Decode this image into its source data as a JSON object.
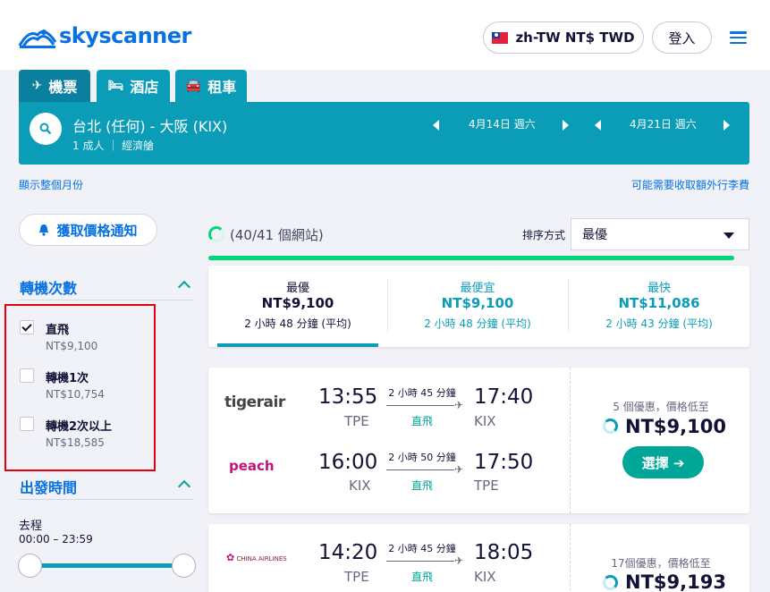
{
  "header": {
    "brand": "skyscanner",
    "locale": "zh-TW NT$ TWD",
    "login": "登入"
  },
  "tabs": [
    {
      "label": "機票",
      "icon": "plane-icon"
    },
    {
      "label": "酒店",
      "icon": "bed-icon"
    },
    {
      "label": "租車",
      "icon": "car-icon"
    }
  ],
  "search": {
    "route": "台北 (任何) - 大阪 (KIX)",
    "pax": "1 成人 ｜ 經濟艙",
    "depart_date": "4月14日 週六",
    "return_date": "4月21日 週六"
  },
  "links": {
    "month_view": "顯示整個月份",
    "baggage_note": "可能需要收取額外行李費"
  },
  "sidebar": {
    "alert_label": "獲取價格通知",
    "stops_title": "轉機次數",
    "stops": [
      {
        "label": "直飛",
        "price": "NT$9,100",
        "checked": true
      },
      {
        "label": "轉機1次",
        "price": "NT$10,754",
        "checked": false
      },
      {
        "label": "轉機2次以上",
        "price": "NT$18,585",
        "checked": false
      }
    ],
    "time_title": "出發時間",
    "outbound_label": "去程",
    "outbound_range": "00:00 – 23:59"
  },
  "results": {
    "sites": "(40/41 個網站)",
    "sort_label": "排序方式",
    "sort_value": "最優",
    "sort_tabs": [
      {
        "title": "最優",
        "price": "NT$9,100",
        "duration": "2 小時 48 分鐘 (平均)"
      },
      {
        "title": "最便宜",
        "price": "NT$9,100",
        "duration": "2 小時 48 分鐘 (平均)"
      },
      {
        "title": "最快",
        "price": "NT$11,086",
        "duration": "2 小時 43 分鐘 (平均)"
      }
    ],
    "cards": [
      {
        "legs": [
          {
            "airline": "tigerair",
            "dep": "13:55",
            "dep_code": "TPE",
            "dur": "2 小時 45 分鐘",
            "type": "直飛",
            "arr": "17:40",
            "arr_code": "KIX"
          },
          {
            "airline": "peach",
            "dep": "16:00",
            "dep_code": "KIX",
            "dur": "2 小時 50 分鐘",
            "type": "直飛",
            "arr": "17:50",
            "arr_code": "TPE"
          }
        ],
        "deals": "5 個優惠，價格低至",
        "price": "NT$9,100",
        "select": "選擇 ➔"
      },
      {
        "legs": [
          {
            "airline": "CHINA AIRLINES",
            "dep": "14:20",
            "dep_code": "TPE",
            "dur": "2 小時 45 分鐘",
            "type": "直飛",
            "arr": "18:05",
            "arr_code": "KIX"
          }
        ],
        "deals": "17個優惠，價格低至",
        "price": "NT$9,193"
      }
    ]
  },
  "colors": {
    "brand_blue": "#0770e3",
    "teal": "#0b9cb8",
    "green": "#00a698",
    "progress_green": "#00d775",
    "highlight_red": "#e3000f"
  }
}
